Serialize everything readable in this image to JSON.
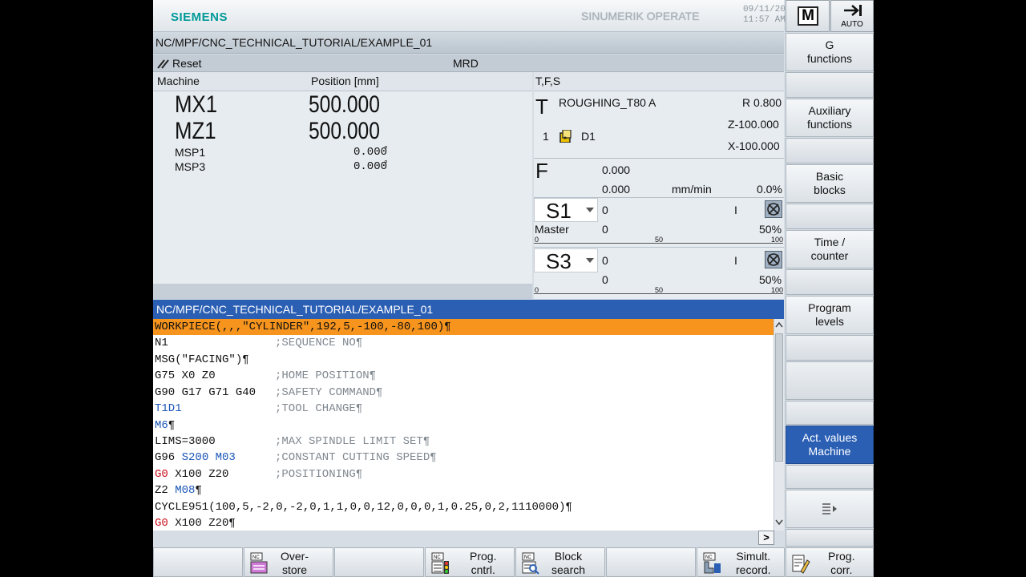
{
  "header": {
    "brand": "SIEMENS",
    "product": "SINUMERIK OPERATE",
    "date": "09/11/20",
    "time": "11:57 AM",
    "mode_button": "M",
    "auto_label": "AUTO"
  },
  "path": "NC/MPF/CNC_TECHNICAL_TUTORIAL/EXAMPLE_01",
  "status": {
    "reset": "Reset",
    "state": "MRD"
  },
  "machine": {
    "col_machine": "Machine",
    "col_position": "Position [mm]",
    "axes": [
      {
        "name": "MX1",
        "value": "500.000"
      },
      {
        "name": "MZ1",
        "value": "500.000"
      }
    ],
    "spindles": [
      {
        "name": "MSP1",
        "value": "0.000",
        "unit": "°"
      },
      {
        "name": "MSP3",
        "value": "0.000",
        "unit": "°"
      }
    ]
  },
  "tfs": {
    "title": "T,F,S",
    "t_letter": "T",
    "tool_name": "ROUGHING_T80 A",
    "tool_r": "R 0.800",
    "tool_z": "Z-100.000",
    "tool_x": "X-100.000",
    "tool_num": "1",
    "tool_d": "D1",
    "f_letter": "F",
    "f_set": "0.000",
    "f_act": "0.000",
    "f_unit": "mm/min",
    "f_pct": "0.0%",
    "s1": {
      "name": "S1",
      "set": "0",
      "act": "0",
      "dir": "I",
      "label": "Master",
      "pct": "50%",
      "tick0": "0",
      "tick50": "50",
      "tick100": "100"
    },
    "s3": {
      "name": "S3",
      "set": "0",
      "act": "0",
      "dir": "I",
      "pct": "50%",
      "tick0": "0",
      "tick50": "50",
      "tick100": "100"
    }
  },
  "editor": {
    "title": "NC/MPF/CNC_TECHNICAL_TUTORIAL/EXAMPLE_01",
    "l0": "WORKPIECE(,,,\"CYLINDER\",192,5,-100,-80,100)¶",
    "l1a": "N1",
    "l1c": ";SEQUENCE NO¶",
    "l2": "MSG(\"FACING\")¶",
    "l3a": "G75 X0 Z0",
    "l3c": ";HOME POSITION¶",
    "l4a": "G90 G17 G71 G40",
    "l4c": ";SAFETY COMMAND¶",
    "l5a": "T1D1",
    "l5c": ";TOOL CHANGE¶",
    "l6a": "M6",
    "l6b": "¶",
    "l7a": "LIMS=3000",
    "l7c": ";MAX SPINDLE LIMIT SET¶",
    "l8a": "G96 ",
    "l8b": "S200 M03",
    "l8c": ";CONSTANT CUTTING SPEED¶",
    "l9a": "G0",
    "l9b": " X100 Z20",
    "l9c": ";POSITIONING¶",
    "l10a": "Z2 ",
    "l10b": "M08",
    "l10c": "¶",
    "l11": "CYCLE951(100,5,-2,0,-2,0,1,1,0,0,12,0,0,0,1,0.25,0,2,1110000)¶",
    "l12a": "G0",
    "l12b": " X100 Z20¶",
    "hscroll": ">"
  },
  "vsoftkeys": {
    "k1": "G\nfunctions",
    "k2": "Auxiliary\nfunctions",
    "k3": "Basic\nblocks",
    "k4": "Time /\ncounter",
    "k5": "Program\nlevels",
    "k7": "Act. values\nMachine"
  },
  "hsoftkeys": {
    "overstore": "Over-\nstore",
    "progcntrl": "Prog.\ncntrl.",
    "blocksearch": "Block\nsearch",
    "simult": "Simult.\nrecord.",
    "progcorr": "Prog.\ncorr."
  },
  "colors": {
    "accent_blue": "#2b5fb4",
    "highlight_orange": "#f7941d",
    "siemens_teal": "#009999"
  }
}
